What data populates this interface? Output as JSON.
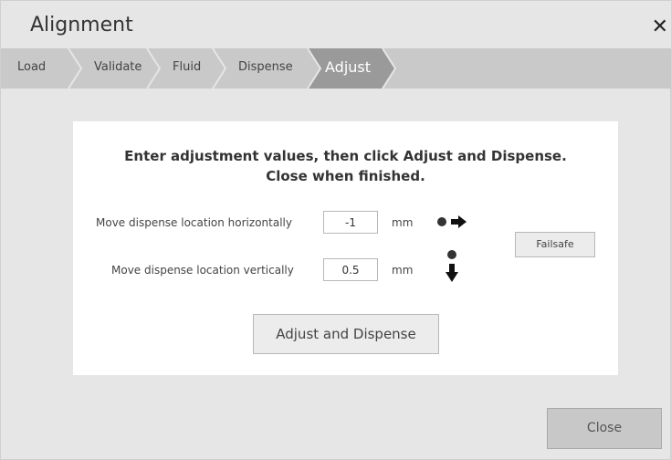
{
  "window": {
    "title": "Alignment"
  },
  "steps": [
    {
      "label": "Load",
      "active": false
    },
    {
      "label": "Validate",
      "active": false
    },
    {
      "label": "Fluid",
      "active": false
    },
    {
      "label": "Dispense",
      "active": false
    },
    {
      "label": "Adjust",
      "active": true
    }
  ],
  "panel": {
    "instruction_line1": "Enter adjustment values, then click Adjust and Dispense.",
    "instruction_line2": "Close when finished.",
    "horizontal": {
      "label": "Move dispense location horizontally",
      "value": "-1",
      "unit": "mm",
      "icon": "dot-arrow-right-icon"
    },
    "vertical": {
      "label": "Move dispense location vertically",
      "value": "0.5",
      "unit": "mm",
      "icon": "dot-arrow-down-icon"
    },
    "failsafe_label": "Failsafe",
    "adjust_label": "Adjust and Dispense"
  },
  "footer": {
    "close_label": "Close"
  },
  "colors": {
    "stepper_bg": "#c9c9c9",
    "active_step": "#9a9a9a",
    "panel_bg": "#ffffff",
    "window_bg": "#e6e6e6"
  }
}
